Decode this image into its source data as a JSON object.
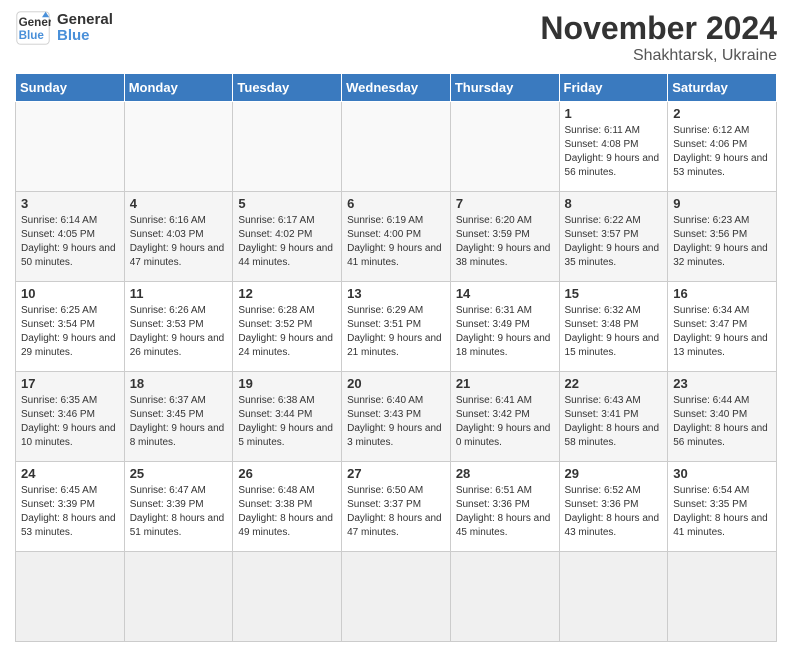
{
  "logo": {
    "line1": "General",
    "line2": "Blue"
  },
  "title": "November 2024",
  "location": "Shakhtarsk, Ukraine",
  "weekdays": [
    "Sunday",
    "Monday",
    "Tuesday",
    "Wednesday",
    "Thursday",
    "Friday",
    "Saturday"
  ],
  "days": [
    {
      "num": "",
      "info": ""
    },
    {
      "num": "",
      "info": ""
    },
    {
      "num": "",
      "info": ""
    },
    {
      "num": "",
      "info": ""
    },
    {
      "num": "",
      "info": ""
    },
    {
      "num": "1",
      "info": "Sunrise: 6:11 AM\nSunset: 4:08 PM\nDaylight: 9 hours and 56 minutes."
    },
    {
      "num": "2",
      "info": "Sunrise: 6:12 AM\nSunset: 4:06 PM\nDaylight: 9 hours and 53 minutes."
    },
    {
      "num": "3",
      "info": "Sunrise: 6:14 AM\nSunset: 4:05 PM\nDaylight: 9 hours and 50 minutes."
    },
    {
      "num": "4",
      "info": "Sunrise: 6:16 AM\nSunset: 4:03 PM\nDaylight: 9 hours and 47 minutes."
    },
    {
      "num": "5",
      "info": "Sunrise: 6:17 AM\nSunset: 4:02 PM\nDaylight: 9 hours and 44 minutes."
    },
    {
      "num": "6",
      "info": "Sunrise: 6:19 AM\nSunset: 4:00 PM\nDaylight: 9 hours and 41 minutes."
    },
    {
      "num": "7",
      "info": "Sunrise: 6:20 AM\nSunset: 3:59 PM\nDaylight: 9 hours and 38 minutes."
    },
    {
      "num": "8",
      "info": "Sunrise: 6:22 AM\nSunset: 3:57 PM\nDaylight: 9 hours and 35 minutes."
    },
    {
      "num": "9",
      "info": "Sunrise: 6:23 AM\nSunset: 3:56 PM\nDaylight: 9 hours and 32 minutes."
    },
    {
      "num": "10",
      "info": "Sunrise: 6:25 AM\nSunset: 3:54 PM\nDaylight: 9 hours and 29 minutes."
    },
    {
      "num": "11",
      "info": "Sunrise: 6:26 AM\nSunset: 3:53 PM\nDaylight: 9 hours and 26 minutes."
    },
    {
      "num": "12",
      "info": "Sunrise: 6:28 AM\nSunset: 3:52 PM\nDaylight: 9 hours and 24 minutes."
    },
    {
      "num": "13",
      "info": "Sunrise: 6:29 AM\nSunset: 3:51 PM\nDaylight: 9 hours and 21 minutes."
    },
    {
      "num": "14",
      "info": "Sunrise: 6:31 AM\nSunset: 3:49 PM\nDaylight: 9 hours and 18 minutes."
    },
    {
      "num": "15",
      "info": "Sunrise: 6:32 AM\nSunset: 3:48 PM\nDaylight: 9 hours and 15 minutes."
    },
    {
      "num": "16",
      "info": "Sunrise: 6:34 AM\nSunset: 3:47 PM\nDaylight: 9 hours and 13 minutes."
    },
    {
      "num": "17",
      "info": "Sunrise: 6:35 AM\nSunset: 3:46 PM\nDaylight: 9 hours and 10 minutes."
    },
    {
      "num": "18",
      "info": "Sunrise: 6:37 AM\nSunset: 3:45 PM\nDaylight: 9 hours and 8 minutes."
    },
    {
      "num": "19",
      "info": "Sunrise: 6:38 AM\nSunset: 3:44 PM\nDaylight: 9 hours and 5 minutes."
    },
    {
      "num": "20",
      "info": "Sunrise: 6:40 AM\nSunset: 3:43 PM\nDaylight: 9 hours and 3 minutes."
    },
    {
      "num": "21",
      "info": "Sunrise: 6:41 AM\nSunset: 3:42 PM\nDaylight: 9 hours and 0 minutes."
    },
    {
      "num": "22",
      "info": "Sunrise: 6:43 AM\nSunset: 3:41 PM\nDaylight: 8 hours and 58 minutes."
    },
    {
      "num": "23",
      "info": "Sunrise: 6:44 AM\nSunset: 3:40 PM\nDaylight: 8 hours and 56 minutes."
    },
    {
      "num": "24",
      "info": "Sunrise: 6:45 AM\nSunset: 3:39 PM\nDaylight: 8 hours and 53 minutes."
    },
    {
      "num": "25",
      "info": "Sunrise: 6:47 AM\nSunset: 3:39 PM\nDaylight: 8 hours and 51 minutes."
    },
    {
      "num": "26",
      "info": "Sunrise: 6:48 AM\nSunset: 3:38 PM\nDaylight: 8 hours and 49 minutes."
    },
    {
      "num": "27",
      "info": "Sunrise: 6:50 AM\nSunset: 3:37 PM\nDaylight: 8 hours and 47 minutes."
    },
    {
      "num": "28",
      "info": "Sunrise: 6:51 AM\nSunset: 3:36 PM\nDaylight: 8 hours and 45 minutes."
    },
    {
      "num": "29",
      "info": "Sunrise: 6:52 AM\nSunset: 3:36 PM\nDaylight: 8 hours and 43 minutes."
    },
    {
      "num": "30",
      "info": "Sunrise: 6:54 AM\nSunset: 3:35 PM\nDaylight: 8 hours and 41 minutes."
    },
    {
      "num": "",
      "info": ""
    },
    {
      "num": "",
      "info": ""
    },
    {
      "num": "",
      "info": ""
    },
    {
      "num": "",
      "info": ""
    },
    {
      "num": "",
      "info": ""
    }
  ]
}
